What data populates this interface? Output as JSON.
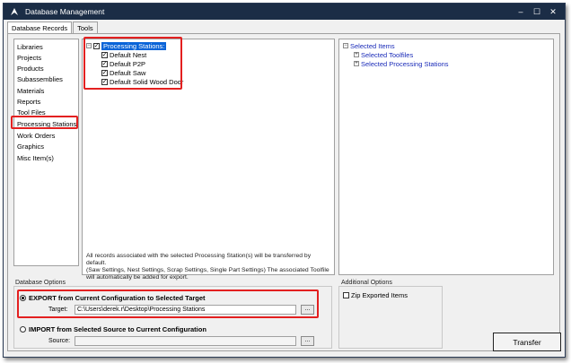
{
  "window": {
    "title": "Database Management",
    "controls": {
      "minimize": "–",
      "maximize": "☐",
      "close": "✕"
    }
  },
  "tabs": [
    {
      "label": "Database Records",
      "active": true
    },
    {
      "label": "Tools",
      "active": false
    }
  ],
  "sidebar": {
    "items": [
      {
        "label": "Libraries"
      },
      {
        "label": "Projects"
      },
      {
        "label": "Products"
      },
      {
        "label": "Subassemblies"
      },
      {
        "label": "Materials"
      },
      {
        "label": "Reports"
      },
      {
        "label": "Tool Files"
      },
      {
        "label": "Processing Stations",
        "highlighted": true
      },
      {
        "label": "Work Orders"
      },
      {
        "label": "Graphics"
      },
      {
        "label": "Misc Item(s)"
      }
    ]
  },
  "tree": {
    "root": {
      "label": "Processing Stations:",
      "checked": true,
      "selected": true
    },
    "children": [
      {
        "label": "Default Nest",
        "checked": true
      },
      {
        "label": "Default P2P",
        "checked": true
      },
      {
        "label": "Default Saw",
        "checked": true
      },
      {
        "label": "Default Solid Wood Door",
        "checked": true
      }
    ],
    "description_line1": "All records associated with the selected Processing Station(s) will be transferred by default.",
    "description_line2": "(Saw Settings, Nest Settings, Scrap Settings, Single Part Settings)  The associated Toolfile",
    "description_line3": "will automatically be added for export."
  },
  "selected_items": {
    "root_label": "Selected Items",
    "children": [
      {
        "label": "Selected Toolfiles"
      },
      {
        "label": "Selected Processing Stations"
      }
    ]
  },
  "database_options": {
    "label": "Database Options",
    "export": {
      "label": "EXPORT from Current Configuration to Selected Target",
      "selected": true,
      "field_label": "Target:",
      "field_value": "C:\\Users\\derek.r\\Desktop\\Processing Stations",
      "browse_label": "..."
    },
    "import": {
      "label": "IMPORT from Selected Source to Current Configuration",
      "selected": false,
      "field_label": "Source:",
      "field_value": "",
      "browse_label": "..."
    }
  },
  "additional_options": {
    "label": "Additional Options",
    "zip_label": "Zip Exported Items",
    "zip_checked": false
  },
  "transfer_button": {
    "label": "Transfer"
  },
  "colors": {
    "titlebar": "#1b2d46",
    "highlight": "#e32020",
    "selection": "#0a64d8",
    "link_blue": "#1a2bb8"
  }
}
